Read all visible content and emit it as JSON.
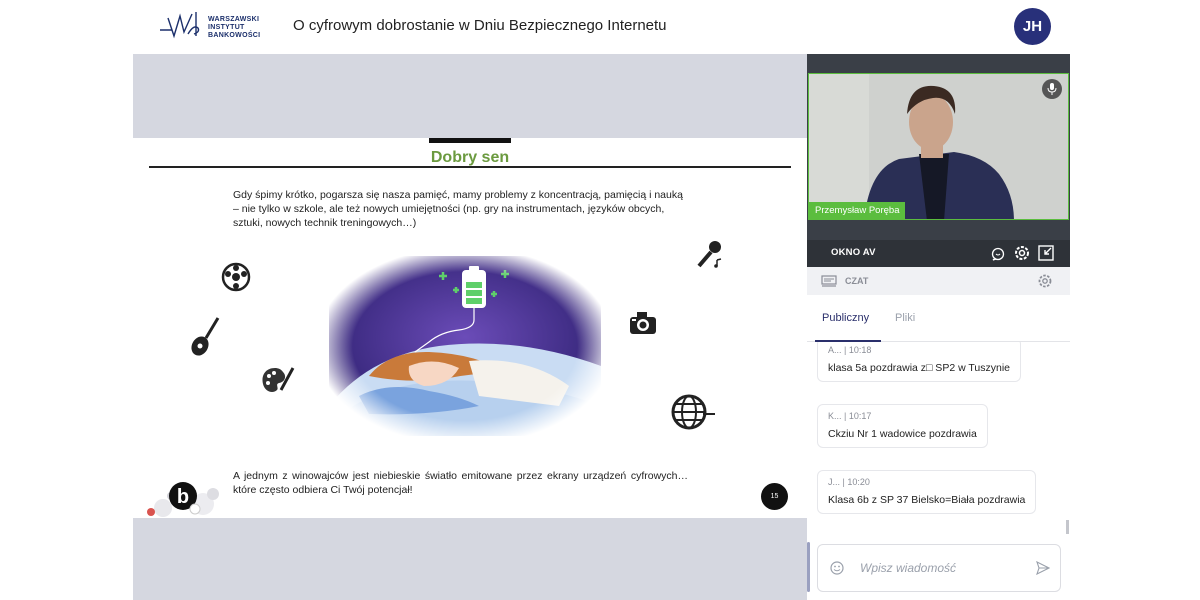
{
  "header": {
    "logo_lines": [
      "WARSZAWSKI",
      "INSTYTUT",
      "BANKOWOŚCI"
    ],
    "title": "O cyfrowym dobrostanie w Dniu Bezpiecznego Internetu",
    "avatar_initials": "JH"
  },
  "slide": {
    "title": "Dobry sen",
    "paragraph1": "Gdy śpimy krótko, pogarsza się nasza pamięć, mamy  problemy z koncentracją, pamięcią i nauką – nie tylko w szkole, ale też nowych umiejętności (np. gry na instrumentach, języków obcych, sztuki, nowych technik treningowych…)",
    "paragraph2": "A jednym z winowajców jest niebieskie światło emitowane przez ekrany urządzeń cyfrowych… które często odbiera Ci Twój potencjał!",
    "page_number": "15",
    "brand_letter": "b",
    "icons": [
      "soccer-ball-icon",
      "guitar-icon",
      "palette-icon",
      "microphone-icon",
      "camera-icon",
      "globe-icon"
    ]
  },
  "av": {
    "participant_name": "Przemysław Poręba",
    "panel_label": "OKNO AV"
  },
  "chat": {
    "header_label": "CZAT",
    "tabs": [
      {
        "label": "Publiczny",
        "active": true
      },
      {
        "label": "Pliki",
        "active": false
      }
    ],
    "messages": [
      {
        "meta": "A...  |  10:18",
        "text": "klasa 5a pozdrawia z□ SP2 w Tuszynie"
      },
      {
        "meta": "K...  |  10:17",
        "text": "Ckziu Nr 1 wadowice pozdrawia"
      },
      {
        "meta": "J...  |  10:20",
        "text": "Klasa 6b z  SP 37  Bielsko=Biała pozdrawia"
      }
    ],
    "input_placeholder": "Wpisz wiadomość"
  },
  "colors": {
    "accent": "#28307a",
    "slide_title": "#6b9a3f",
    "speaker_tag": "#5bbd3e",
    "stage_bg": "#d5d7e0"
  }
}
